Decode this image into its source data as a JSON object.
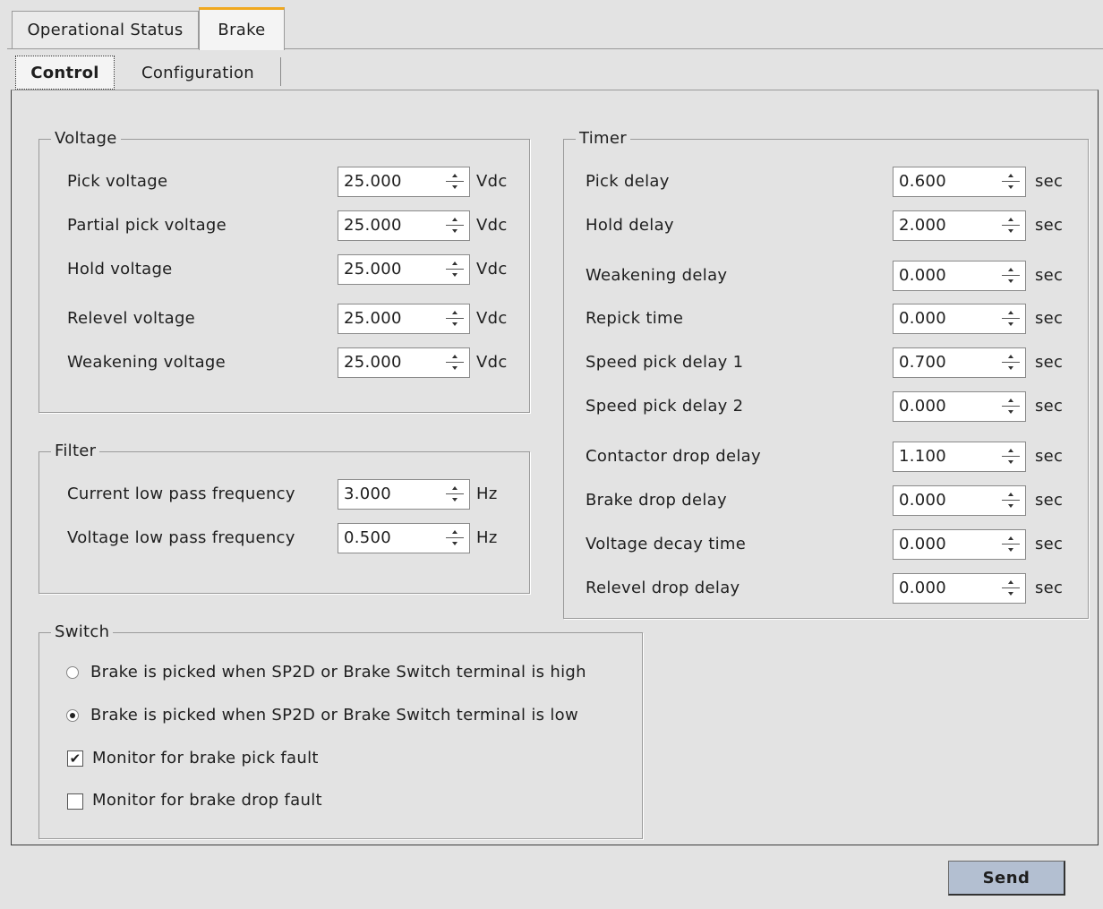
{
  "tabs": {
    "top": [
      "Operational Status",
      "Brake"
    ],
    "active_top": "Brake",
    "sub": [
      "Control",
      "Configuration"
    ],
    "active_sub": "Control"
  },
  "voltage": {
    "title": "Voltage",
    "rows": [
      {
        "label": "Pick voltage",
        "value": "25.000",
        "unit": "Vdc"
      },
      {
        "label": "Partial pick voltage",
        "value": "25.000",
        "unit": "Vdc"
      },
      {
        "label": "Hold voltage",
        "value": "25.000",
        "unit": "Vdc"
      },
      {
        "label": "Relevel voltage",
        "value": "25.000",
        "unit": "Vdc"
      },
      {
        "label": "Weakening voltage",
        "value": "25.000",
        "unit": "Vdc"
      }
    ]
  },
  "filter": {
    "title": "Filter",
    "rows": [
      {
        "label": "Current low pass frequency",
        "value": "3.000",
        "unit": "Hz"
      },
      {
        "label": "Voltage low pass frequency",
        "value": "0.500",
        "unit": "Hz"
      }
    ]
  },
  "timer": {
    "title": "Timer",
    "rows": [
      {
        "label": "Pick delay",
        "value": "0.600",
        "unit": "sec"
      },
      {
        "label": "Hold delay",
        "value": "2.000",
        "unit": "sec"
      },
      {
        "label": "Weakening delay",
        "value": "0.000",
        "unit": "sec"
      },
      {
        "label": "Repick time",
        "value": "0.000",
        "unit": "sec"
      },
      {
        "label": "Speed pick delay 1",
        "value": "0.700",
        "unit": "sec"
      },
      {
        "label": "Speed pick delay 2",
        "value": "0.000",
        "unit": "sec"
      },
      {
        "label": "Contactor drop delay",
        "value": "1.100",
        "unit": "sec"
      },
      {
        "label": "Brake drop delay",
        "value": "0.000",
        "unit": "sec"
      },
      {
        "label": "Voltage decay time",
        "value": "0.000",
        "unit": "sec"
      },
      {
        "label": "Relevel drop delay",
        "value": "0.000",
        "unit": "sec"
      }
    ]
  },
  "switch": {
    "title": "Switch",
    "radios": [
      {
        "label": "Brake is picked when SP2D or Brake Switch terminal is high",
        "selected": false
      },
      {
        "label": "Brake is picked when SP2D or Brake Switch terminal is low",
        "selected": true
      }
    ],
    "checks": [
      {
        "label": "Monitor for brake pick fault",
        "checked": true
      },
      {
        "label": "Monitor for brake drop fault",
        "checked": false
      }
    ]
  },
  "send_label": "Send"
}
